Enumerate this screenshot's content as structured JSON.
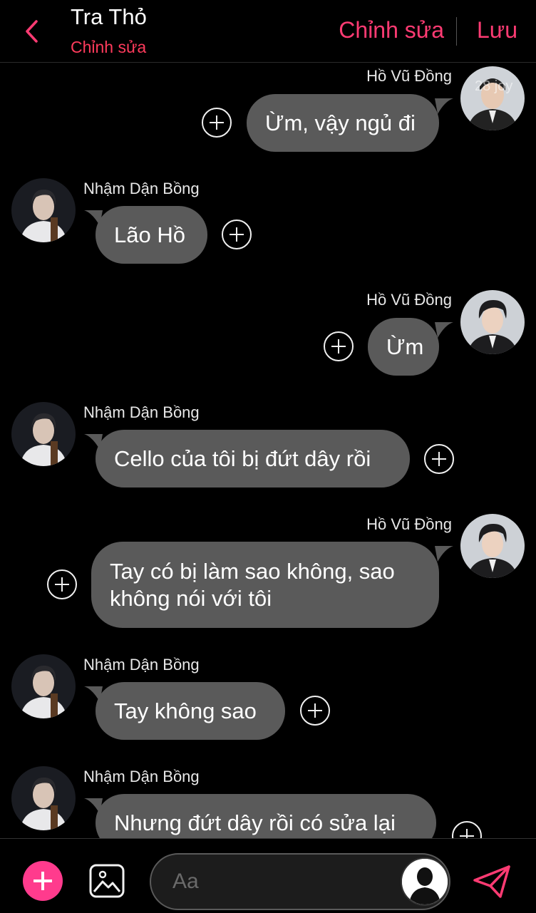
{
  "header": {
    "title": "Tra Thỏ",
    "subtitle": "Chỉnh sửa",
    "edit_label": "Chỉnh sửa",
    "save_label": "Lưu",
    "back_icon": "chevron-left-icon"
  },
  "watermark": "28 joy",
  "messages": [
    {
      "sender": "Hồ Vũ Đồng",
      "side": "right",
      "text": "Ừm, vậy ngủ đi"
    },
    {
      "sender": "Nhậm Dận Bồng",
      "side": "left",
      "text": "Lão Hồ"
    },
    {
      "sender": "Hồ Vũ Đồng",
      "side": "right",
      "text": "Ừm"
    },
    {
      "sender": "Nhậm Dận Bồng",
      "side": "left",
      "text": "Cello của tôi bị đứt dây rồi"
    },
    {
      "sender": "Hồ Vũ Đồng",
      "side": "right",
      "text_line1": "Tay có bị làm sao không, sao",
      "text_line2": "không nói với tôi"
    },
    {
      "sender": "Nhậm Dận Bồng",
      "side": "left",
      "text": "Tay không sao"
    },
    {
      "sender": "Nhậm Dận Bồng",
      "side": "left",
      "text": "Nhưng đứt dây rồi có sửa lại"
    }
  ],
  "composer": {
    "placeholder": "Aa",
    "icons": [
      "plus-icon",
      "image-icon",
      "avatar-icon",
      "send-icon"
    ]
  },
  "colors": {
    "accent": "#ff3b73",
    "subtitle": "#ff3b5c",
    "bubble": "#5a5a5a",
    "background": "#000000"
  }
}
